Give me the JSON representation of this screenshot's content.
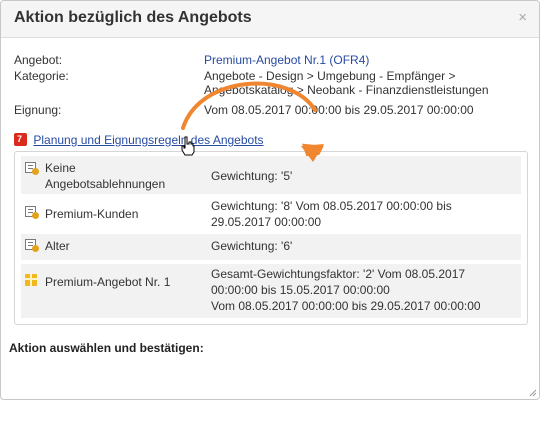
{
  "dialog": {
    "title": "Aktion bezüglich des Angebots",
    "close_glyph": "×"
  },
  "fields": {
    "offer_label": "Angebot:",
    "offer_value": "Premium-Angebot Nr.1 (OFR4)",
    "category_label": "Kategorie:",
    "category_line1": "Angebote - Design > Umgebung - Empfänger >",
    "category_line2": "Angebotskatalog > Neobank - Finanzdienstleistungen",
    "eligibility_label": "Eignung:",
    "eligibility_value": "Vom 08.05.2017 00:00:00 bis 29.05.2017 00:00:00"
  },
  "rules_link": {
    "label": "Planung und Eignungsregeln des Angebots",
    "icon": "calendar-icon"
  },
  "rules": [
    {
      "name_line1": "Keine",
      "name_line2": "Angebotsablehnungen",
      "value_line1": "Gewichtung: '5'",
      "value_line2": "",
      "value_line3": "",
      "icon": "rule-list-icon"
    },
    {
      "name_line1": "Premium-Kunden",
      "name_line2": "",
      "value_line1": "Gewichtung: '8' Vom 08.05.2017 00:00:00 bis",
      "value_line2": "29.05.2017 00:00:00",
      "value_line3": "",
      "icon": "rule-list-icon"
    },
    {
      "name_line1": "Alter",
      "name_line2": "",
      "value_line1": "Gewichtung: '6'",
      "value_line2": "",
      "value_line3": "",
      "icon": "rule-list-icon"
    },
    {
      "name_line1": "Premium-Angebot Nr. 1",
      "name_line2": "",
      "value_line1": "Gesamt-Gewichtungsfaktor: '2' Vom 08.05.2017",
      "value_line2": "00:00:00 bis 15.05.2017 00:00:00",
      "value_line3": "Vom 08.05.2017 00:00:00 bis 29.05.2017 00:00:00",
      "icon": "gift-icon"
    }
  ],
  "footer": {
    "action_label": "Aktion auswählen und bestätigen:"
  },
  "colors": {
    "link": "#274ba1",
    "arrow": "#f0862f",
    "row_bg": "#f2f2f2"
  }
}
